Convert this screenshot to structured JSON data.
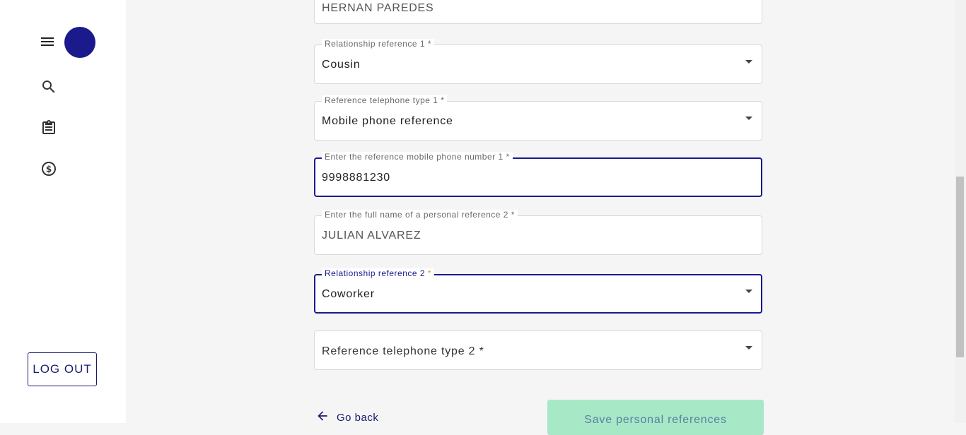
{
  "sidebar": {
    "icons": [
      "menu-icon",
      "search-icon",
      "clipboard-icon",
      "dollar-circle-icon"
    ],
    "avatar_color": "#1a1a8c",
    "logout_label": "LOG OUT"
  },
  "form": {
    "name_ref1": {
      "value": "HERNAN PAREDES"
    },
    "relationship_ref1": {
      "label": "Relationship reference 1 *",
      "value": "Cousin"
    },
    "phone_type_ref1": {
      "label": "Reference telephone type 1 *",
      "value": "Mobile phone reference"
    },
    "mobile_ref1": {
      "label": "Enter the reference mobile phone number 1 *",
      "value": "9998881230"
    },
    "name_ref2": {
      "label": "Enter the full name of a personal reference 2 *",
      "value": "JULIAN ALVAREZ"
    },
    "relationship_ref2": {
      "label": "Relationship reference 2",
      "required_mark": "*",
      "value": "Coworker"
    },
    "phone_type_ref2": {
      "placeholder": "Reference telephone type 2 *"
    }
  },
  "actions": {
    "go_back_label": "Go back",
    "save_label": "Save personal references"
  },
  "colors": {
    "accent": "#1a1a8c",
    "save_button_bg": "#a7e8c7",
    "required_accent": "#d4a017"
  }
}
